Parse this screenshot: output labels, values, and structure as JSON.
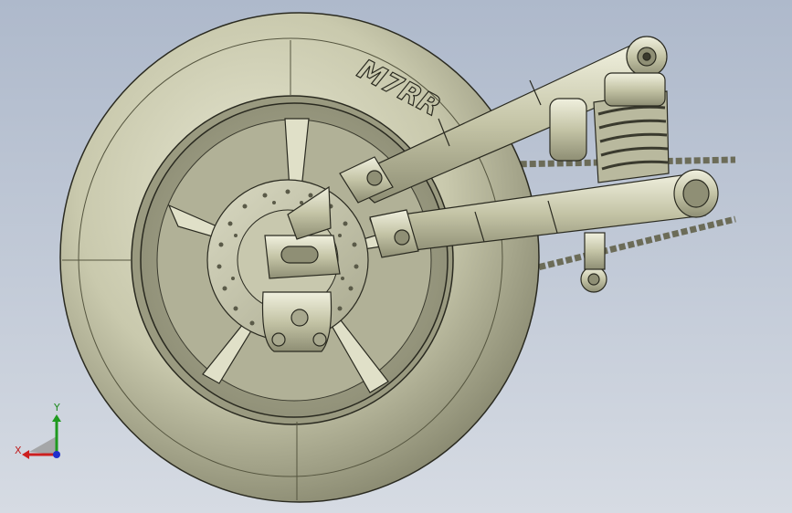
{
  "viewport": {
    "background_top": "#aeb9cb",
    "background_bottom": "#d6dbe3",
    "model_color": "#c6c6aa",
    "edge_color": "#2a2a20"
  },
  "tire": {
    "sidewall_text": "M7RR"
  },
  "triad": {
    "x_label": "X",
    "y_label": "Y",
    "x_color": "#cc1f1f",
    "y_color": "#1f9a1f",
    "z_color": "#1f2fcc"
  }
}
